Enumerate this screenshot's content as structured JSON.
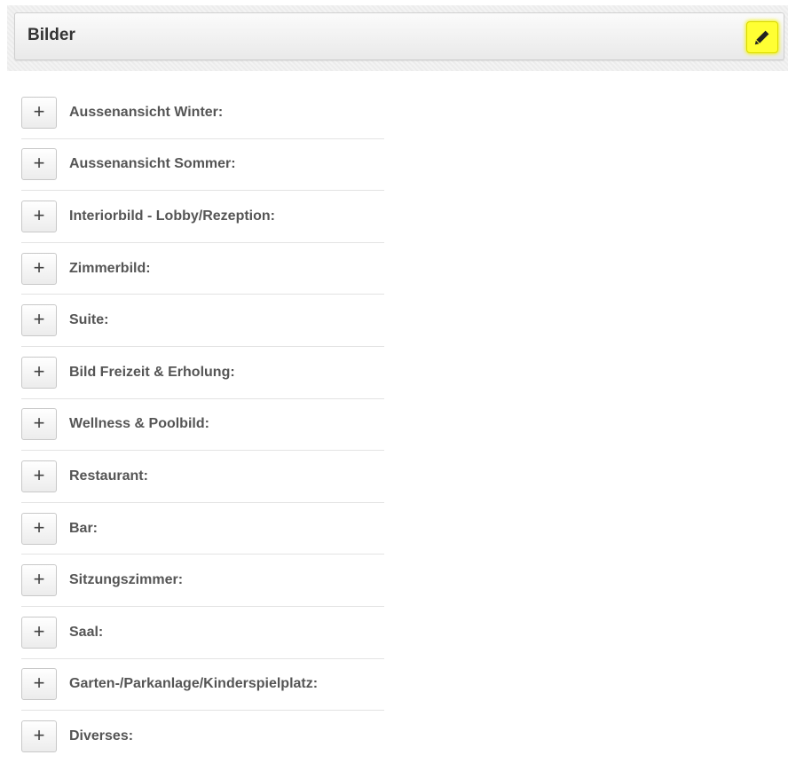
{
  "panel": {
    "title": "Bilder",
    "edit_icon": "pencil-icon",
    "edit_highlight_color": "#ffff33"
  },
  "items": [
    {
      "label": "Aussenansicht Winter:",
      "icon": "plus-icon",
      "icon_glyph": "+"
    },
    {
      "label": "Aussenansicht Sommer:",
      "icon": "plus-icon",
      "icon_glyph": "+"
    },
    {
      "label": "Interiorbild - Lobby/Rezeption:",
      "icon": "plus-icon",
      "icon_glyph": "+"
    },
    {
      "label": "Zimmerbild:",
      "icon": "plus-icon",
      "icon_glyph": "+"
    },
    {
      "label": "Suite:",
      "icon": "plus-icon",
      "icon_glyph": "+"
    },
    {
      "label": "Bild Freizeit & Erholung:",
      "icon": "plus-icon",
      "icon_glyph": "+"
    },
    {
      "label": "Wellness & Poolbild:",
      "icon": "plus-icon",
      "icon_glyph": "+"
    },
    {
      "label": "Restaurant:",
      "icon": "plus-icon",
      "icon_glyph": "+"
    },
    {
      "label": "Bar:",
      "icon": "plus-icon",
      "icon_glyph": "+"
    },
    {
      "label": "Sitzungszimmer:",
      "icon": "plus-icon",
      "icon_glyph": "+"
    },
    {
      "label": "Saal:",
      "icon": "plus-icon",
      "icon_glyph": "+"
    },
    {
      "label": "Garten-/Parkanlage/Kinderspielplatz:",
      "icon": "plus-icon",
      "icon_glyph": "+"
    },
    {
      "label": "Diverses:",
      "icon": "plus-icon",
      "icon_glyph": "+"
    }
  ]
}
